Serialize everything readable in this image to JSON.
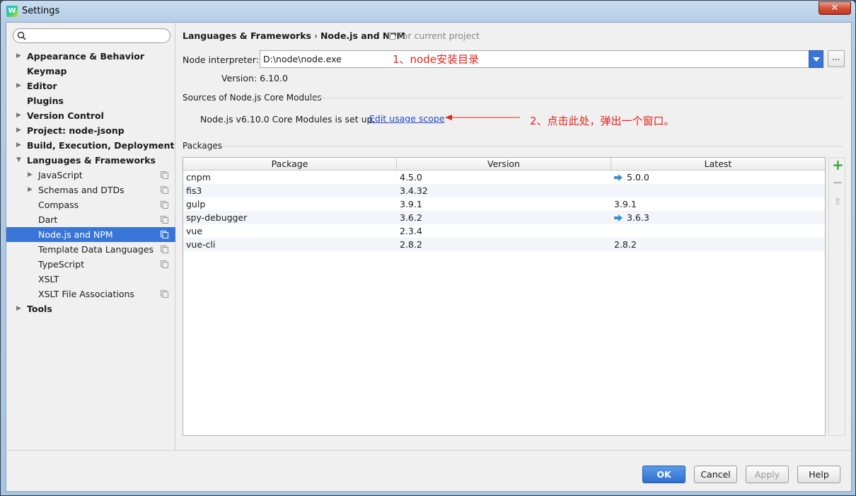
{
  "window": {
    "title": "Settings",
    "close_label": "✕"
  },
  "sidebar": {
    "search_placeholder": "",
    "items": [
      {
        "label": "Appearance & Behavior",
        "bold": true,
        "arrow": true,
        "level": 0,
        "proj": false
      },
      {
        "label": "Keymap",
        "bold": true,
        "arrow": false,
        "level": 0,
        "proj": false
      },
      {
        "label": "Editor",
        "bold": true,
        "arrow": true,
        "level": 0,
        "proj": false
      },
      {
        "label": "Plugins",
        "bold": true,
        "arrow": false,
        "level": 0,
        "proj": false
      },
      {
        "label": "Version Control",
        "bold": true,
        "arrow": true,
        "level": 0,
        "proj": false
      },
      {
        "label": "Project: node-jsonp",
        "bold": true,
        "arrow": true,
        "level": 0,
        "proj": false
      },
      {
        "label": "Build, Execution, Deployment",
        "bold": true,
        "arrow": true,
        "level": 0,
        "proj": false
      },
      {
        "label": "Languages & Frameworks",
        "bold": true,
        "arrow": "open",
        "level": 0,
        "proj": false
      },
      {
        "label": "JavaScript",
        "bold": false,
        "arrow": true,
        "level": 1,
        "proj": true
      },
      {
        "label": "Schemas and DTDs",
        "bold": false,
        "arrow": true,
        "level": 1,
        "proj": true
      },
      {
        "label": "Compass",
        "bold": false,
        "arrow": false,
        "level": 1,
        "proj": true
      },
      {
        "label": "Dart",
        "bold": false,
        "arrow": false,
        "level": 1,
        "proj": true
      },
      {
        "label": "Node.js and NPM",
        "bold": false,
        "arrow": false,
        "level": 1,
        "proj": true,
        "selected": true
      },
      {
        "label": "Template Data Languages",
        "bold": false,
        "arrow": false,
        "level": 1,
        "proj": true
      },
      {
        "label": "TypeScript",
        "bold": false,
        "arrow": false,
        "level": 1,
        "proj": true
      },
      {
        "label": "XSLT",
        "bold": false,
        "arrow": false,
        "level": 1,
        "proj": false
      },
      {
        "label": "XSLT File Associations",
        "bold": false,
        "arrow": false,
        "level": 1,
        "proj": true
      },
      {
        "label": "Tools",
        "bold": true,
        "arrow": true,
        "level": 0,
        "proj": false
      }
    ]
  },
  "header": {
    "crumb_parent": "Languages & Frameworks",
    "crumb_sep": "›",
    "crumb_current": "Node.js and NPM",
    "scope_note": "For current project"
  },
  "interpreter": {
    "label": "Node interpreter:",
    "value": "D:\\node\\node.exe",
    "annotation": "1、node安装目录",
    "browse_label": "...",
    "version_text": "Version: 6.10.0"
  },
  "core_modules": {
    "section_title": "Sources of Node.js Core Modules",
    "status_text": "Node.js v6.10.0 Core Modules is set up.",
    "link_text": "Edit usage scope",
    "annotation": "2、点击此处，弹出一个窗口。"
  },
  "packages": {
    "section_title": "Packages",
    "columns": [
      "Package",
      "Version",
      "Latest"
    ],
    "rows": [
      {
        "package": "cnpm",
        "version": "4.5.0",
        "latest": "5.0.0",
        "upgrade": true
      },
      {
        "package": "fis3",
        "version": "3.4.32",
        "latest": "",
        "upgrade": false
      },
      {
        "package": "gulp",
        "version": "3.9.1",
        "latest": "3.9.1",
        "upgrade": false
      },
      {
        "package": "spy-debugger",
        "version": "3.6.2",
        "latest": "3.6.3",
        "upgrade": true
      },
      {
        "package": "vue",
        "version": "2.3.4",
        "latest": "",
        "upgrade": false
      },
      {
        "package": "vue-cli",
        "version": "2.8.2",
        "latest": "2.8.2",
        "upgrade": false
      }
    ],
    "tools": {
      "add": "+",
      "remove": "−",
      "upgrade": "⇧"
    }
  },
  "buttons": {
    "ok": "OK",
    "cancel": "Cancel",
    "apply": "Apply",
    "help": "Help"
  }
}
